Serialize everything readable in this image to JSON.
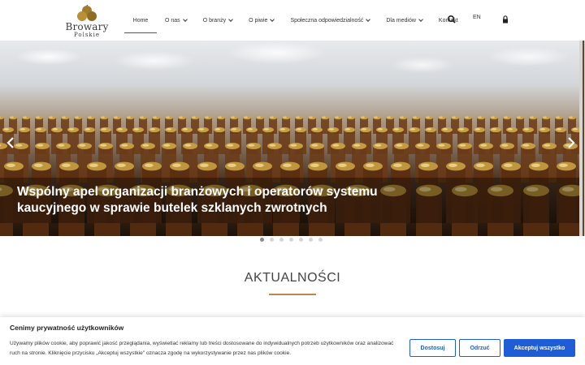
{
  "logo": {
    "line1": "Browary",
    "line2": "Polskie",
    "color": "#a07d2e"
  },
  "nav": {
    "items": [
      {
        "label": "Home",
        "has_dropdown": false,
        "active": true
      },
      {
        "label": "O nas",
        "has_dropdown": true
      },
      {
        "label": "O branży",
        "has_dropdown": true
      },
      {
        "label": "O piwie",
        "has_dropdown": true
      },
      {
        "label": "Społeczna odpowiedzialność",
        "has_dropdown": true
      },
      {
        "label": "Dla mediów",
        "has_dropdown": true
      },
      {
        "label": "Kontakt",
        "has_dropdown": false
      }
    ],
    "search_icon": "search-icon",
    "language": "EN",
    "lock_icon": "lock-icon"
  },
  "hero": {
    "title": "Wspólny apel organizacji branżowych i operatorów systemu kaucyjnego w sprawie butelek szklanych zwrotnych",
    "prev_icon": "chevron-left-icon",
    "next_icon": "chevron-right-icon",
    "slide_count": 7,
    "active_slide": 1
  },
  "section": {
    "title": "AKTUALNOŚCI",
    "accent": "#b88a4f"
  },
  "cookie": {
    "title": "Cenimy prywatność użytkowników",
    "text": "Używamy plików cookie, aby poprawić jakość przeglądania, wyświetlać reklamy lub treści dostosowane do indywidualnych potrzeb użytkowników oraz analizować ruch na stronie. Kliknięcie przycisku „Akceptuj wszystkie\" oznacza zgodę na wykorzystywanie przez nas plików cookie.",
    "customize_label": "Dostosuj",
    "reject_label": "Odrzuć",
    "accept_label": "Akceptuj wszystko",
    "accent": "#1e5dd6"
  }
}
